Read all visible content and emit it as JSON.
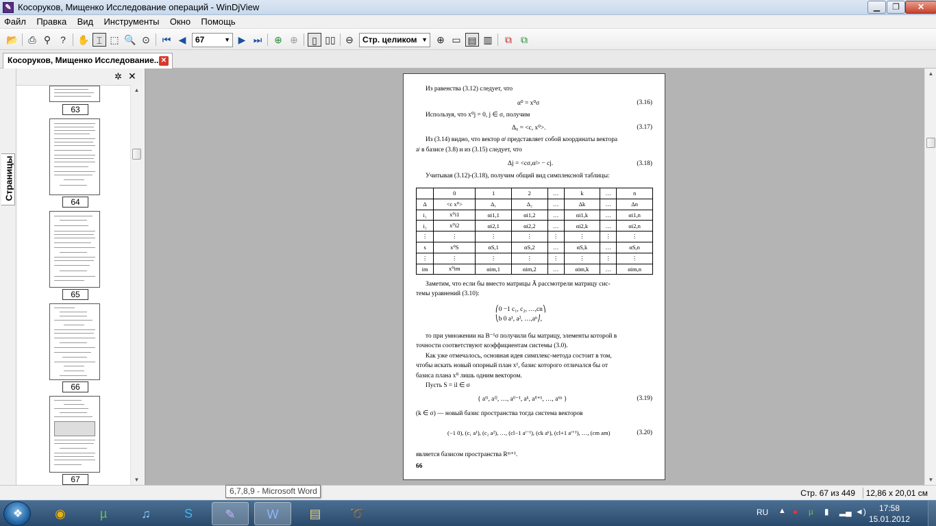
{
  "window": {
    "title": "Косоруков, Мищенко Исследование операций - WinDjView",
    "app_icon": "djview-icon"
  },
  "menu": [
    "Файл",
    "Правка",
    "Вид",
    "Инструменты",
    "Окно",
    "Помощь"
  ],
  "toolbar": {
    "page_value": "67",
    "zoom_value": "Стр. целиком"
  },
  "doc_tab": {
    "label": "Косоруков, Мищенко Исследование..."
  },
  "sidebar": {
    "tab_label": "Страницы",
    "thumbnails": [
      "63",
      "64",
      "65",
      "66",
      "67"
    ]
  },
  "page": {
    "lines": [
      "Из равенства (3.12) следует, что",
      "α⁰ = x⁰σ",
      "(3.16)",
      "Используя, что x⁰j = 0, j ∈ σ, получим",
      "Δ₀ = <c, x⁰>.",
      "(3.17)",
      "Из (3.14) видно, что вектор αʲ представляет собой координаты вектора",
      "aʲ в базисе (3.8) и из (3.15) следует, что",
      "Δj = <cσ,αʲ> − cj.",
      "(3.18)",
      "Учитывая (3.12)-(3.18), получим общий вид симплексной таблицы:"
    ],
    "table": [
      [
        "",
        "0",
        "1",
        "2",
        "…",
        "k",
        "…",
        "n"
      ],
      [
        "Δ",
        "<c x⁰>",
        "Δ₁",
        "Δ₂",
        "…",
        "Δk",
        "…",
        "Δn"
      ],
      [
        "i₁",
        "x⁰i1",
        "αi1,1",
        "αi1,2",
        "…",
        "αi1,k",
        "…",
        "αi1,n"
      ],
      [
        "i₂",
        "x⁰i2",
        "αi2,1",
        "αi2,2",
        "…",
        "αi2,k",
        "…",
        "αi2,n"
      ],
      [
        "⋮",
        "⋮",
        "⋮",
        "⋮",
        "⋮",
        "⋮",
        "⋮",
        "⋮"
      ],
      [
        "s",
        "x⁰S",
        "αS,1",
        "αS,2",
        "…",
        "αS,k",
        "…",
        "αS,n"
      ],
      [
        "⋮",
        "⋮",
        "⋮",
        "⋮",
        "⋮",
        "⋮",
        "⋮",
        "⋮"
      ],
      [
        "im",
        "x⁰im",
        "αim,1",
        "αim,2",
        "…",
        "αim,k",
        "…",
        "αim,n"
      ]
    ],
    "lines2": [
      "Заметим, что если бы вместо матрицы Ã рассмотрели матрицу сис-",
      "темы уравнений (3.10):",
      "⎛0  −1   c₁,  c₂, …,cn⎞",
      "⎝b   0   a¹,  a², …,aⁿ⎠,",
      "то при умножении на B⁻¹σ получили бы матрицу, элементы которой в",
      "точности соответствуют коэффициентам системы (3.0).",
      "Как уже отмечалось, основная идея симплекс-метода состоит в том,",
      "чтобы искать новый опорный план x¹, базис которого отличался бы от",
      "базиса плана x⁰ лишь одним вектором.",
      "Пусть S = il ∈ σ",
      "{ aⁱ¹, aⁱ², …, aⁱˡ⁻¹, aᵏ, aⁱˡ⁺¹, …, aⁱᵐ }",
      "(3.19)",
      "(k ∈ σ) — новый базис пространства тогда система векторов",
      "(−1 0), (c₁ a¹), (c₂ a²), …, (cl−1 aˡ⁻¹), (ck aᵏ), (cl+1 aˡ⁺¹), …, (cm am)",
      "(3.20)",
      "является базисом пространства Rᵐ⁺¹.",
      "66"
    ]
  },
  "tooltip": "6,7,8,9 - Microsoft Word",
  "status": {
    "page_info": "Стр. 67 из 449",
    "size_info": "12,86 x 20,01 см"
  },
  "taskbar": {
    "lang": "RU",
    "time": "17:58",
    "date": "15.01.2012"
  }
}
